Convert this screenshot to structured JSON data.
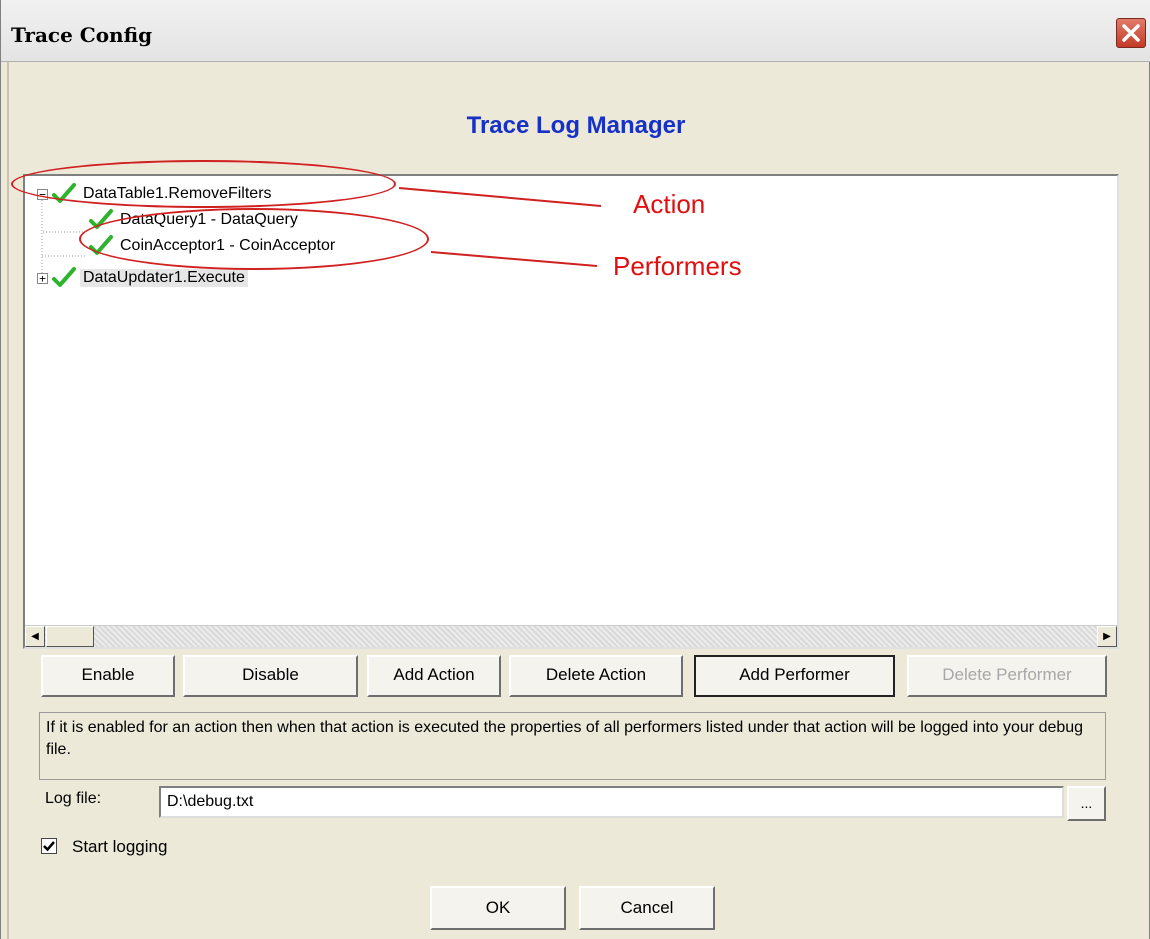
{
  "window": {
    "title": "Trace Config"
  },
  "heading": "Trace Log Manager",
  "tree": {
    "nodes": [
      {
        "label": "DataTable1.RemoveFilters",
        "expander": "−",
        "checked": true
      },
      {
        "label": "DataQuery1 - DataQuery",
        "checked": true
      },
      {
        "label": "CoinAcceptor1 - CoinAcceptor",
        "checked": true
      },
      {
        "label": "DataUpdater1.Execute",
        "expander": "+",
        "checked": true,
        "selected": true
      }
    ]
  },
  "annotations": {
    "action": "Action",
    "performers": "Performers"
  },
  "buttons": {
    "enable": "Enable",
    "disable": "Disable",
    "add_action": "Add Action",
    "delete_action": "Delete Action",
    "add_performer": "Add Performer",
    "delete_performer": "Delete Performer"
  },
  "info_text": "If it is enabled for an action then when that action is executed the properties of all performers listed under that action will be logged into your debug file.",
  "log_file": {
    "label": "Log file:",
    "value": "D:\\debug.txt",
    "browse": "..."
  },
  "start_logging": {
    "label": "Start logging",
    "checked": true
  },
  "footer": {
    "ok": "OK",
    "cancel": "Cancel"
  },
  "colors": {
    "heading": "#1630c8",
    "annotation": "#e01010",
    "check": "#2fb32f"
  }
}
